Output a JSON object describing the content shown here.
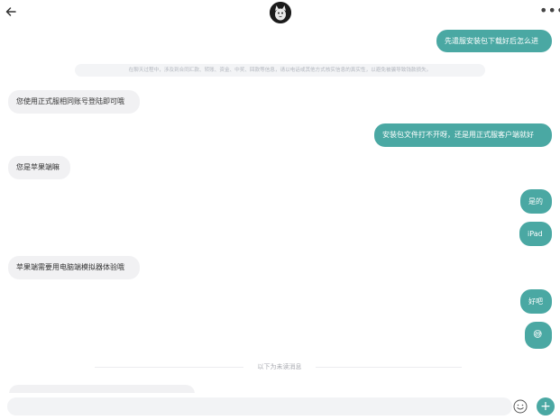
{
  "messages": [
    {
      "dir": "out",
      "text": "先遣服安装包下载好后怎么进"
    },
    {
      "dir": "in",
      "text": "您使用正式服相同账号登陆即可哦"
    },
    {
      "dir": "out",
      "text": "安装包文件打不开呀，还是用正式服客户端就好"
    },
    {
      "dir": "in",
      "text": "您是苹果端嘛"
    },
    {
      "dir": "out",
      "text": "是的"
    },
    {
      "dir": "out",
      "text": "iPad"
    },
    {
      "dir": "in",
      "text": "苹果端需要用电脑端模拟器体验哦"
    },
    {
      "dir": "out",
      "text": "好吧"
    },
    {
      "dir": "out",
      "text": "😅"
    }
  ],
  "notice": "在聊天过程中，涉及到合同汇款、转账、资金、中奖、回款等信息，请以电话或其他方式核实信息的真实性，以避免被骗导致钱款损失。",
  "divider": "以下为未读消息",
  "composer": {
    "placeholder": "",
    "plus": "+"
  },
  "colors": {
    "accent": "#4aa8a3",
    "incoming": "#f1f1f3"
  },
  "icons": {
    "back": "arrow-left",
    "more": "ellipsis",
    "emoji": "smiley",
    "avatar": "user-avatar"
  }
}
